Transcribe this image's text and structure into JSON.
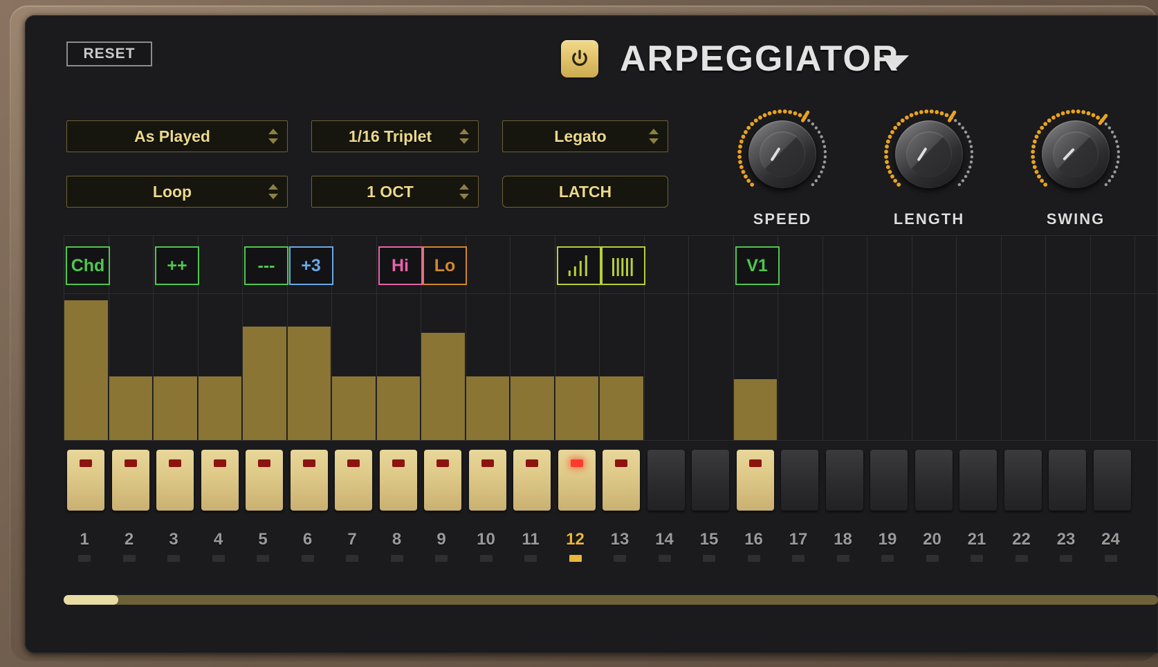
{
  "header": {
    "reset_label": "RESET",
    "title": "ARPEGGIATOR",
    "power_icon": "power-icon",
    "caret_icon": "chevron-down-icon",
    "power_on": true
  },
  "selectors": [
    {
      "name": "order",
      "value": "As Played",
      "has_spinner": true
    },
    {
      "name": "rate",
      "value": "1/16 Triplet",
      "has_spinner": true
    },
    {
      "name": "note-mode",
      "value": "Legato",
      "has_spinner": true
    },
    {
      "name": "play-mode",
      "value": "Loop",
      "has_spinner": true
    },
    {
      "name": "octave",
      "value": "1 OCT",
      "has_spinner": true
    }
  ],
  "buttons": [
    {
      "name": "latch",
      "label": "LATCH"
    }
  ],
  "knobs": [
    {
      "name": "speed",
      "label": "SPEED",
      "value_pct": 62
    },
    {
      "name": "length",
      "label": "LENGTH",
      "value_pct": 62
    },
    {
      "name": "swing",
      "label": "SWING",
      "value_pct": 66
    }
  ],
  "badges": [
    {
      "step": 1,
      "label": "Chd",
      "color": "#4fc74f",
      "kind": "text"
    },
    {
      "step": 3,
      "label": "++",
      "color": "#4fc74f",
      "kind": "text"
    },
    {
      "step": 5,
      "label": "---",
      "color": "#4fc74f",
      "kind": "text"
    },
    {
      "step": 6,
      "label": "+3",
      "color": "#6aa8e8",
      "kind": "text"
    },
    {
      "step": 8,
      "label": "Hi",
      "color": "#e863a8",
      "kind": "text"
    },
    {
      "step": 9,
      "label": "Lo",
      "color": "#d1872c",
      "kind": "text"
    },
    {
      "step": 12,
      "label": "",
      "color": "#b7cf3a",
      "kind": "ramp-bars-icon"
    },
    {
      "step": 13,
      "label": "",
      "color": "#b7cf3a",
      "kind": "even-bars-icon"
    },
    {
      "step": 16,
      "label": "V1",
      "color": "#4fc74f",
      "kind": "text"
    }
  ],
  "sequencer": {
    "visible_steps": 24,
    "current_step": 12,
    "bar_color": "#8a7535",
    "velocities": [
      96,
      44,
      44,
      44,
      78,
      78,
      44,
      44,
      74,
      44,
      44,
      44,
      44,
      0,
      0,
      42,
      0,
      0,
      0,
      0,
      0,
      0,
      0,
      0
    ],
    "pads_on": [
      true,
      true,
      true,
      true,
      true,
      true,
      true,
      true,
      true,
      true,
      true,
      true,
      true,
      false,
      false,
      true,
      false,
      false,
      false,
      false,
      false,
      false,
      false,
      false
    ],
    "step_numbers": [
      "1",
      "2",
      "3",
      "4",
      "5",
      "6",
      "7",
      "8",
      "9",
      "10",
      "11",
      "12",
      "13",
      "14",
      "15",
      "16",
      "17",
      "18",
      "19",
      "20",
      "21",
      "22",
      "23",
      "24"
    ]
  },
  "scrollbar": {
    "name": "horizontal-scrollbar",
    "thumb_pct": 5
  },
  "colors": {
    "accent_gold": "#ecd98b",
    "panel_bg": "#1b1b1d",
    "bar": "#8a7535",
    "pad_on": "#ddc887",
    "led_on": "#ff3b2e",
    "current_step": "#eab73a"
  }
}
